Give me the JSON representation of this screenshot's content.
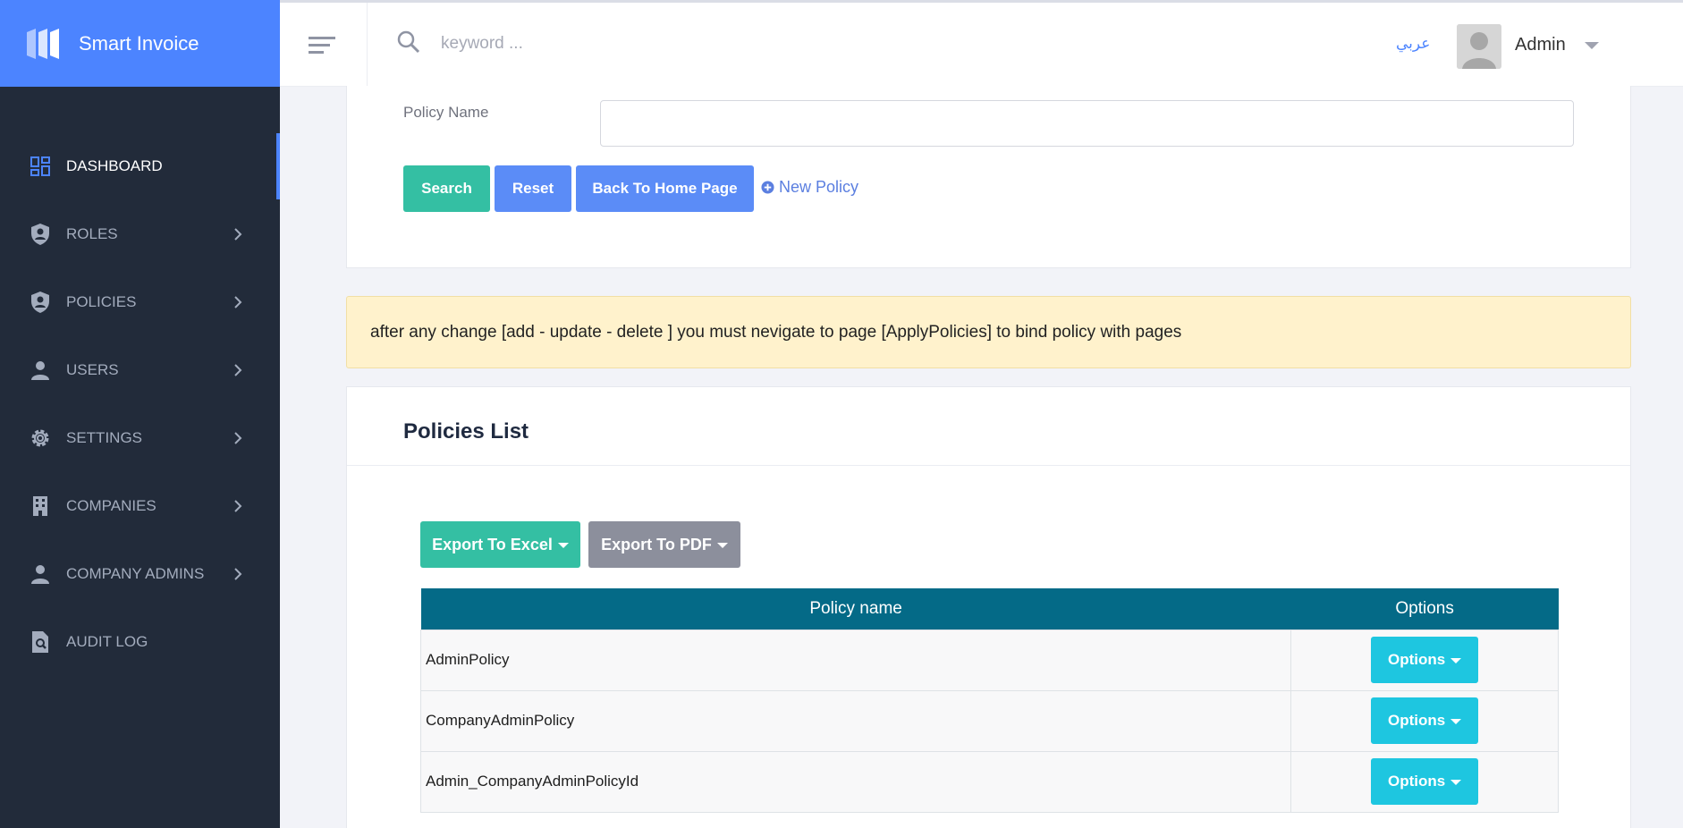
{
  "brand": {
    "title": "Smart Invoice",
    "color": "#4c84ff"
  },
  "sidebar": {
    "items": [
      {
        "label": "DASHBOARD",
        "icon": "dashboard-icon",
        "active": true,
        "has_chevron": false
      },
      {
        "label": "ROLES",
        "icon": "shield-user-icon",
        "has_chevron": true
      },
      {
        "label": "POLICIES",
        "icon": "shield-user-icon",
        "has_chevron": true
      },
      {
        "label": "USERS",
        "icon": "person-icon",
        "has_chevron": true
      },
      {
        "label": "SETTINGS",
        "icon": "gear-icon",
        "has_chevron": true
      },
      {
        "label": "COMPANIES",
        "icon": "building-icon",
        "has_chevron": true
      },
      {
        "label": "COMPANY ADMINS",
        "icon": "person-icon",
        "has_chevron": true
      },
      {
        "label": "AUDIT LOG",
        "icon": "file-search-icon",
        "has_chevron": false
      }
    ]
  },
  "header": {
    "search_placeholder": "keyword ...",
    "language_link": "عربي",
    "user_name": "Admin"
  },
  "search_form": {
    "field_label": "Policy Name",
    "field_value": "",
    "search_button": "Search",
    "reset_button": "Reset",
    "home_button": "Back To Home Page",
    "new_policy_link": "New Policy"
  },
  "alert": {
    "text": "after any change [add - update - delete ] you must nevigate to page [ApplyPolicies] to bind policy with pages"
  },
  "policies_list": {
    "title": "Policies List",
    "export_excel": "Export To Excel",
    "export_pdf": "Export To PDF",
    "columns": [
      "Policy name",
      "Options"
    ],
    "rows": [
      {
        "name": "AdminPolicy",
        "options_label": "Options"
      },
      {
        "name": "CompanyAdminPolicy",
        "options_label": "Options"
      },
      {
        "name": "Admin_CompanyAdminPolicyId",
        "options_label": "Options"
      }
    ]
  },
  "colors": {
    "accent": "#4c84ff",
    "success": "#34bfa3",
    "info": "#1ec6e0",
    "table_header": "#046a87",
    "sidebar_bg": "#222b3a"
  }
}
